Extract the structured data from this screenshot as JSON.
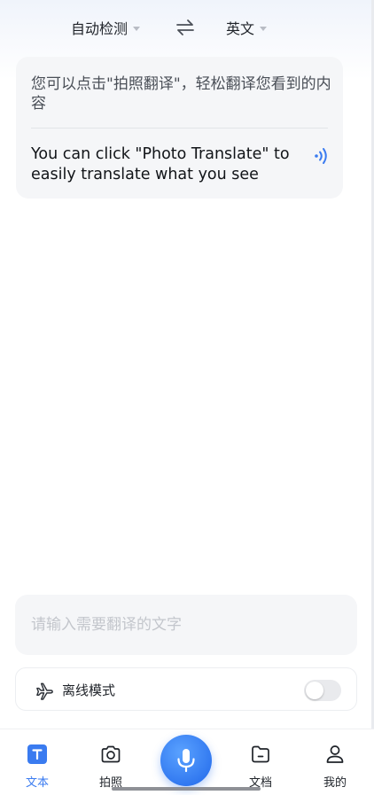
{
  "language_bar": {
    "source_language": "自动检测",
    "target_language": "英文",
    "swap_icon": "swap-arrows-icon"
  },
  "result": {
    "source_text": "您可以点击\"拍照翻译\"，轻松翻译您看到的内容",
    "translated_text": "You can click \"Photo Translate\" to easily translate what you see",
    "speaker_icon": "speaker-icon"
  },
  "input": {
    "placeholder": "请输入需要翻译的文字",
    "value": ""
  },
  "offline_mode": {
    "label": "离线模式",
    "enabled": false,
    "icon": "airplane-icon"
  },
  "bottom_nav": {
    "tabs": [
      {
        "label": "文本",
        "icon": "text-t-icon",
        "active": true
      },
      {
        "label": "拍照",
        "icon": "camera-icon",
        "active": false
      },
      {
        "label": "文档",
        "icon": "document-folder-icon",
        "active": false
      },
      {
        "label": "我的",
        "icon": "person-icon",
        "active": false
      }
    ],
    "mic_icon": "microphone-icon"
  },
  "colors": {
    "accent": "#3a7bf0",
    "card_background": "#f5f6f8"
  }
}
